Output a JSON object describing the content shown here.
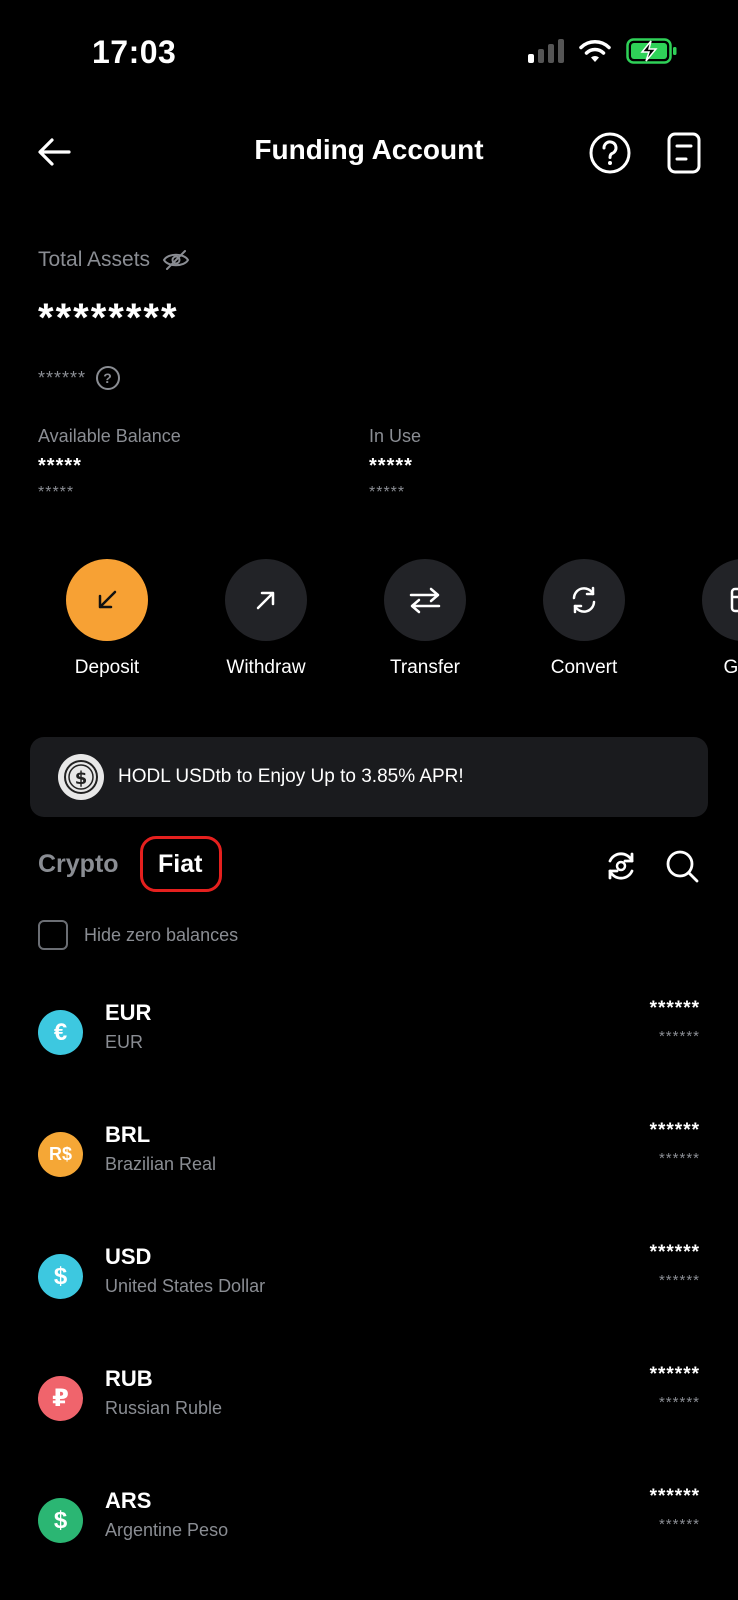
{
  "status": {
    "time": "17:03"
  },
  "header": {
    "title": "Funding Account"
  },
  "assets": {
    "total_label": "Total Assets",
    "total_value": "********",
    "sub_value": "******",
    "available_label": "Available Balance",
    "available_value": "*****",
    "available_sub": "*****",
    "inuse_label": "In Use",
    "inuse_value": "*****",
    "inuse_sub": "*****"
  },
  "actions": [
    {
      "label": "Deposit",
      "icon": "arrow-down-left-icon"
    },
    {
      "label": "Withdraw",
      "icon": "arrow-up-right-icon"
    },
    {
      "label": "Transfer",
      "icon": "swap-arrows-icon"
    },
    {
      "label": "Convert",
      "icon": "refresh-icon"
    },
    {
      "label": "Give",
      "icon": "gift-icon"
    }
  ],
  "promo": {
    "text": "HODL USDtb to Enjoy Up to 3.85% APR!"
  },
  "tabs": {
    "crypto": "Crypto",
    "fiat": "Fiat",
    "active": "Fiat"
  },
  "filter": {
    "hide_zero_label": "Hide zero balances",
    "checked": false
  },
  "currencies": [
    {
      "code": "EUR",
      "name": "EUR",
      "symbol": "€",
      "color": "#3dc8e0",
      "amount": "******",
      "sub": "******"
    },
    {
      "code": "BRL",
      "name": "Brazilian Real",
      "symbol": "R$",
      "color": "#f5a736",
      "amount": "******",
      "sub": "******"
    },
    {
      "code": "USD",
      "name": "United States Dollar",
      "symbol": "$",
      "color": "#3dc8e0",
      "amount": "******",
      "sub": "******"
    },
    {
      "code": "RUB",
      "name": "Russian Ruble",
      "symbol": "₽",
      "color": "#f0646c",
      "amount": "******",
      "sub": "******"
    },
    {
      "code": "ARS",
      "name": "Argentine Peso",
      "symbol": "$",
      "color": "#2bb673",
      "amount": "******",
      "sub": "******"
    }
  ],
  "colors": {
    "accent": "#f7a134",
    "highlight": "#e5201e",
    "background": "#000000"
  }
}
